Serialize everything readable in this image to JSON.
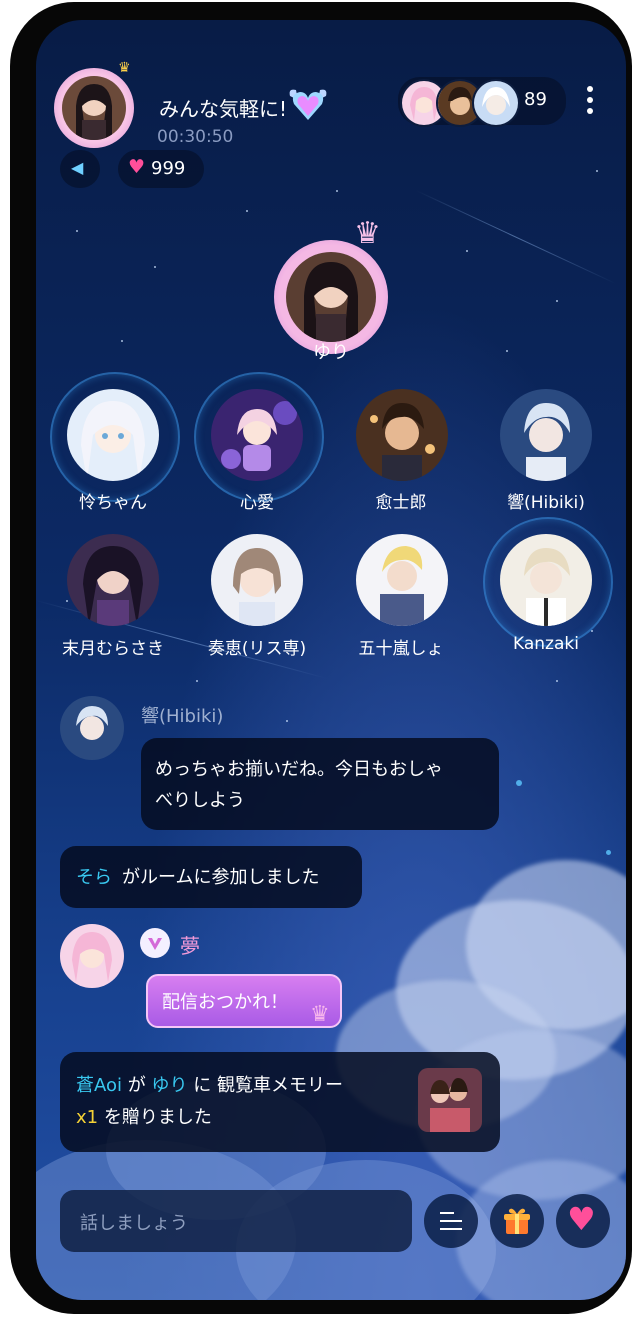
{
  "header": {
    "room_title": "みんな気軽に!",
    "timer": "00:30:50",
    "audience_count": "89",
    "like_count": "999"
  },
  "host": {
    "name": "ゆり"
  },
  "seats": [
    {
      "name": "怜ちゃん"
    },
    {
      "name": "心愛"
    },
    {
      "name": "愈士郎"
    },
    {
      "name": "響(Hibiki)"
    },
    {
      "name": "末月むらさき"
    },
    {
      "name": "奏恵(リス専)"
    },
    {
      "name": "五十嵐しょ"
    },
    {
      "name": "Kanzaki"
    }
  ],
  "chat": {
    "msg1": {
      "sender": "響(Hibiki)",
      "line1": "めっちゃお揃いだね。今日もおしゃ",
      "line2": "べりしよう"
    },
    "join": {
      "user": "そら",
      "text": "がルームに参加しました"
    },
    "msg2": {
      "sender": "夢",
      "text": "配信おつかれ！"
    },
    "gift": {
      "sender": "蒼Aoi",
      "ga": "が",
      "recipient": "ゆり",
      "ni": "に",
      "gift_name": "観覧車メモリー",
      "count": "x1",
      "suffix": "を贈りました"
    }
  },
  "input": {
    "placeholder": "話しましょう"
  },
  "icons": [
    "more-icon",
    "speaker-icon",
    "heart-icon",
    "menu-icon",
    "gift-icon",
    "like-icon"
  ],
  "colors": {
    "accent_cyan": "#39c8f0",
    "accent_yellow": "#f5d236",
    "heart_pink": "#ff4f9a",
    "gift_orange": "#ff7a2e"
  }
}
